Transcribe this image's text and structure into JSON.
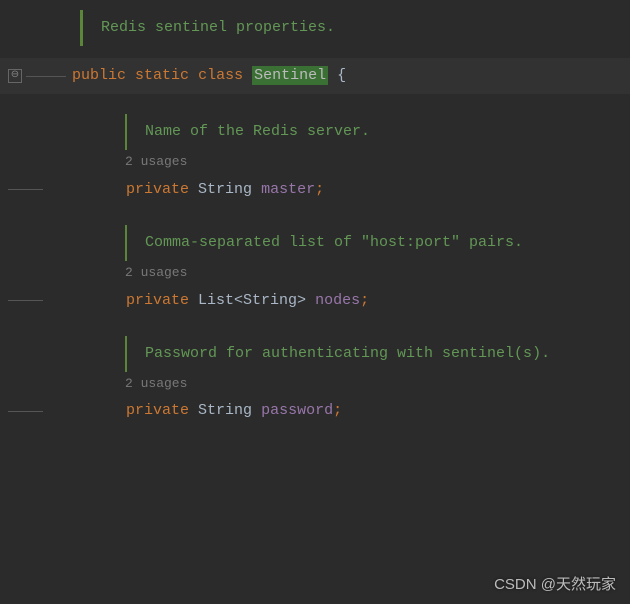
{
  "class_doc": "Redis sentinel properties.",
  "class_decl": {
    "kw_public": "public",
    "kw_static": "static",
    "kw_class": "class",
    "name": "Sentinel",
    "brace": "{"
  },
  "fields": [
    {
      "doc": "Name of the Redis server.",
      "usages": "2 usages",
      "kw_private": "private",
      "type_pre": "String",
      "type_generic": "",
      "type_post": "",
      "name": "master",
      "semi": ";"
    },
    {
      "doc": "Comma-separated list of \"host:port\" pairs.",
      "usages": "2 usages",
      "kw_private": "private",
      "type_pre": "List",
      "type_generic": "<String>",
      "type_post": "",
      "name": "nodes",
      "semi": ";"
    },
    {
      "doc": "Password for authenticating with sentinel(s).",
      "usages": "2 usages",
      "kw_private": "private",
      "type_pre": "String",
      "type_generic": "",
      "type_post": "",
      "name": "password",
      "semi": ";"
    }
  ],
  "fold_symbol": "⊖",
  "watermark": "CSDN @天然玩家"
}
